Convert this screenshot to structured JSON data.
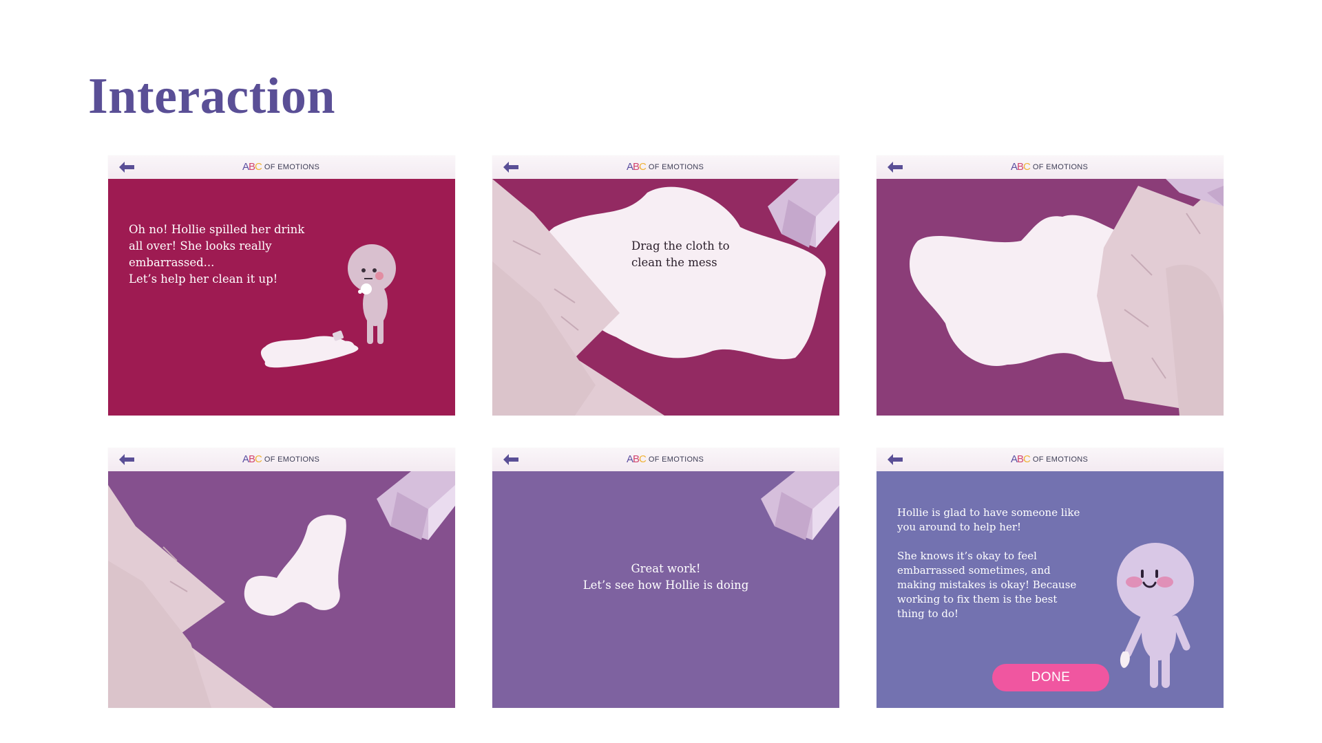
{
  "page": {
    "title": "Interaction"
  },
  "logo": {
    "a": "A",
    "b": "B",
    "c": "C",
    "text": "OF EMOTIONS"
  },
  "screens": [
    {
      "background": "#9e1b52",
      "text": "Oh no! Hollie spilled her drink\nall over! She looks really\nembarrassed...\nLet’s help her clean it up!"
    },
    {
      "background": "#932a62",
      "text": "Drag the cloth to\nclean the mess"
    },
    {
      "background": "#8b3d78",
      "text": ""
    },
    {
      "background": "#85508e",
      "text": ""
    },
    {
      "background": "#7e62a0",
      "text": "Great work!\nLet’s see how Hollie is doing"
    },
    {
      "background": "#7372b0",
      "text": "Hollie is glad to have someone like\nyou around to help her!\n\nShe knows it’s okay to feel\nembarrassed sometimes, and\nmaking mistakes is okay! Because\nworking to fix them is the best\nthing to do!",
      "done_label": "DONE"
    }
  ],
  "colors": {
    "title": "#5a4f96",
    "back_arrow": "#5a4f96",
    "spill": "#f7eef4",
    "cloth": "#e2ccd4",
    "crystal": "#d6bfdc",
    "done_button": "#f056a0"
  },
  "icons": {
    "back": "arrow-left-icon",
    "crystal": "crystal-icon"
  }
}
